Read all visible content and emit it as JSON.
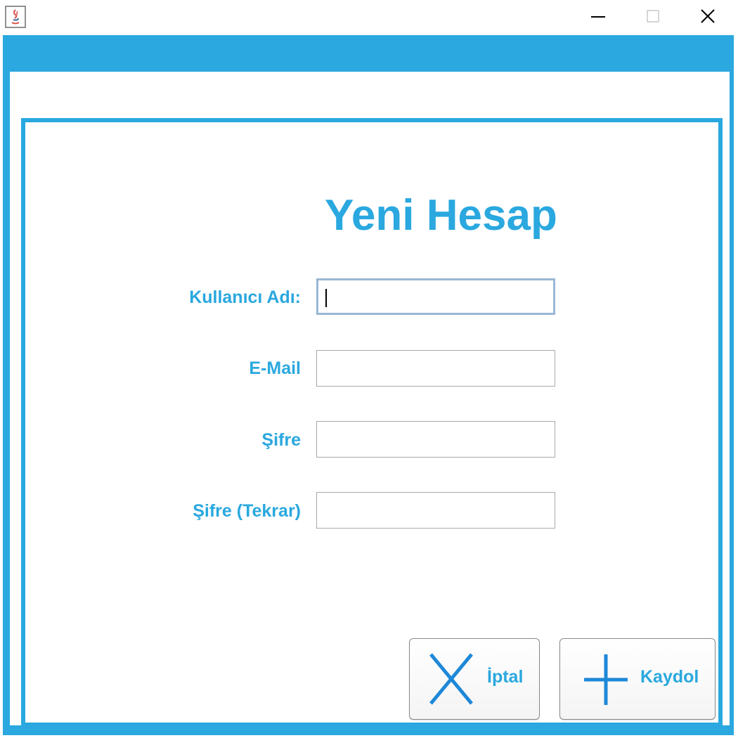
{
  "window": {
    "app_icon": "java-icon",
    "controls": [
      "minimize-icon",
      "maximize-icon",
      "close-icon"
    ]
  },
  "form": {
    "title": "Yeni Hesap",
    "fields": [
      {
        "label": "Kullanıcı Adı:",
        "value": "",
        "focused": true
      },
      {
        "label": "E-Mail",
        "value": ""
      },
      {
        "label": "Şifre",
        "value": ""
      },
      {
        "label": "Şifre (Tekrar)",
        "value": ""
      }
    ]
  },
  "buttons": {
    "cancel": {
      "label": "İptal",
      "icon": "x-icon"
    },
    "register": {
      "label": "Kaydol",
      "icon": "plus-icon"
    }
  },
  "colors": {
    "accent": "#2aa8df",
    "icon_blue": "#1e88d8"
  }
}
